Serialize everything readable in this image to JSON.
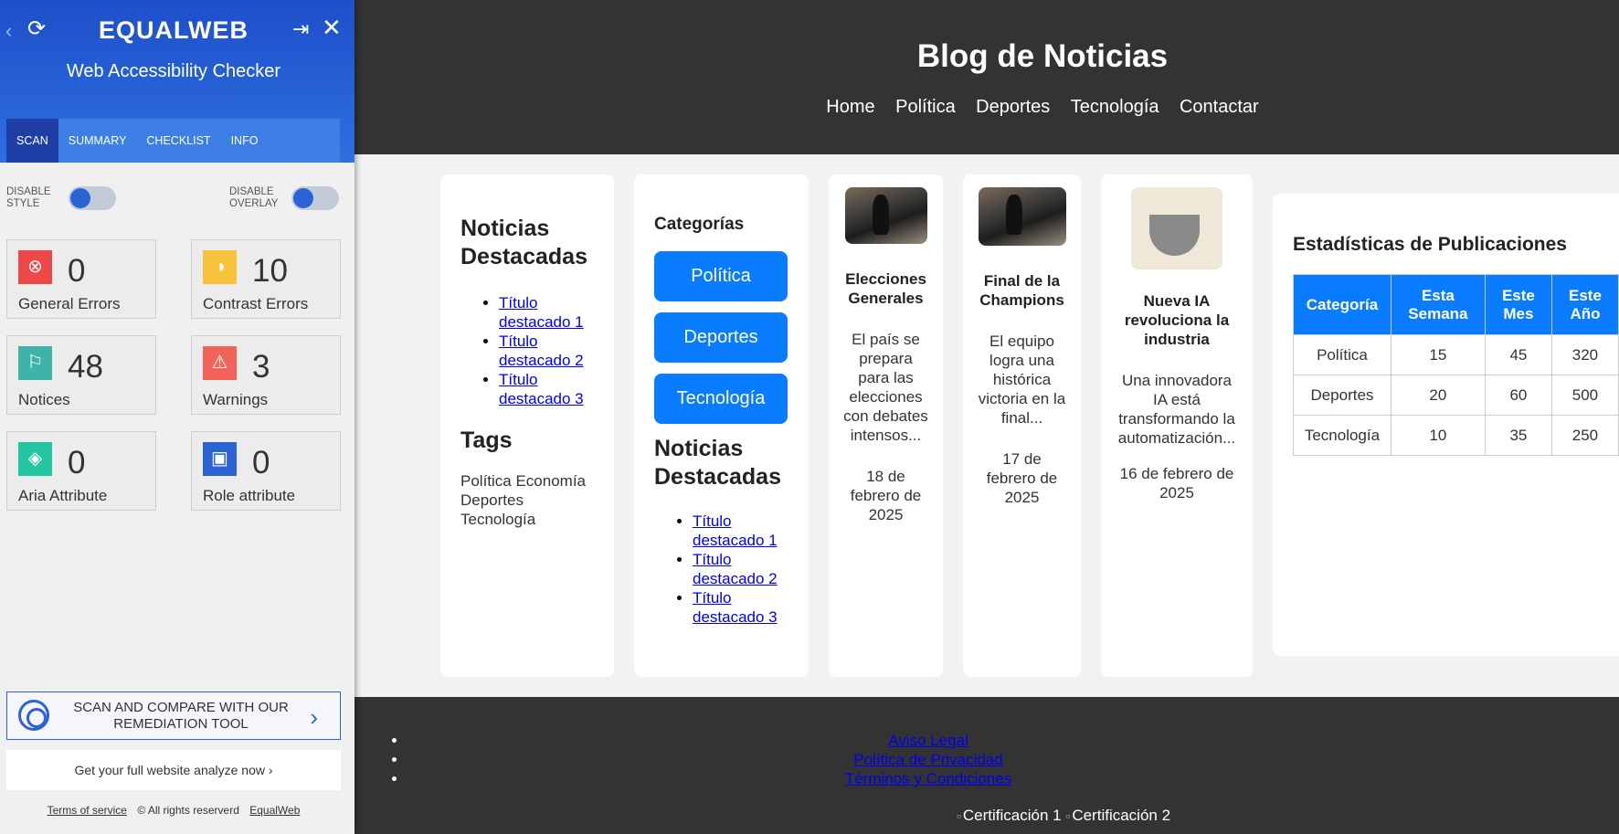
{
  "panel": {
    "logo": "EQUALWEB",
    "title": "Web Accessibility Checker",
    "tabs": [
      {
        "label": "SCAN",
        "active": true
      },
      {
        "label": "SUMMARY"
      },
      {
        "label": "CHECKLIST"
      },
      {
        "label": "INFO"
      }
    ],
    "toggles": {
      "disable_style": "DISABLE STYLE",
      "disable_overlay": "DISABLE OVERLAY"
    },
    "stats": [
      {
        "label": "General Errors",
        "count": "0",
        "icon": "error-hexagon-icon",
        "color": "#ef4848"
      },
      {
        "label": "Contrast Errors",
        "count": "10",
        "icon": "contrast-icon",
        "color": "#f9c23c"
      },
      {
        "label": "Notices",
        "count": "48",
        "icon": "flag-icon",
        "color": "#3fb3a8"
      },
      {
        "label": "Warnings",
        "count": "3",
        "icon": "warning-icon",
        "color": "#f2635a"
      },
      {
        "label": "Aria Attribute",
        "count": "0",
        "icon": "cube-icon",
        "color": "#24c6a2"
      },
      {
        "label": "Role attribute",
        "count": "0",
        "icon": "id-badge-icon",
        "color": "#2b62d6"
      }
    ],
    "remediation_button": "SCAN AND COMPARE WITH OUR REMEDIATION TOOL",
    "analyze_link": "Get your full website analyze now ›",
    "footer": {
      "terms": "Terms of service",
      "rights": "© All rights reserverd",
      "brand": "EqualWeb"
    }
  },
  "site": {
    "title": "Blog de Noticias",
    "nav": [
      "Home",
      "Política",
      "Deportes",
      "Tecnología",
      "Contactar"
    ],
    "featured": {
      "heading": "Noticias Destacadas",
      "items": [
        "Título destacado 1",
        "Título destacado 2",
        "Título destacado 3"
      ],
      "tags_heading": "Tags",
      "tags": "Política Economía Deportes Tecnología"
    },
    "categories": {
      "heading": "Categorías",
      "buttons": [
        "Política",
        "Deportes",
        "Tecnología"
      ],
      "featured_heading": "Noticias Destacadas",
      "featured_items": [
        "Título destacado 1",
        "Título destacado 2",
        "Título destacado 3"
      ]
    },
    "news": [
      {
        "title": "Elecciones Generales",
        "desc": "El país se prepara para las elecciones con debates intensos...",
        "date": "18 de febrero de 2025"
      },
      {
        "title": "Final de la Champions",
        "desc": "El equipo logra una histórica victoria en la final...",
        "date": "17 de febrero de 2025"
      },
      {
        "title": "Nueva IA revoluciona la industria",
        "desc": "Una innovadora IA está transformando la automatización...",
        "date": "16 de febrero de 2025"
      }
    ],
    "stats": {
      "heading": "Estadísticas de Publicaciones",
      "headers": [
        "Categoría",
        "Esta Semana",
        "Este Mes",
        "Este Año"
      ],
      "rows": [
        [
          "Política",
          "15",
          "45",
          "320"
        ],
        [
          "Deportes",
          "20",
          "60",
          "500"
        ],
        [
          "Tecnología",
          "10",
          "35",
          "250"
        ]
      ]
    },
    "footer": {
      "links": [
        "Aviso Legal",
        "Política de Privacidad",
        "Términos y Condiciones"
      ],
      "certs": [
        "Certificación 1",
        "Certificación 2"
      ]
    }
  }
}
